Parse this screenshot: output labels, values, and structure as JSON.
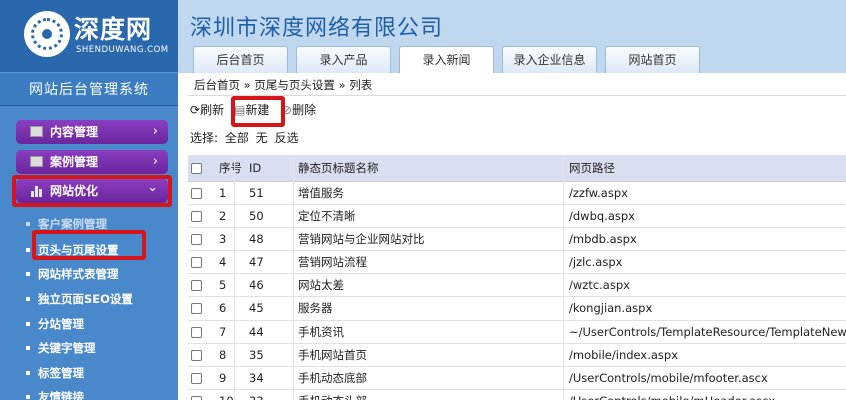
{
  "brand": {
    "name_cn": "深度网",
    "name_en": "SHENDUWANG.COM"
  },
  "system_title": "网站后台管理系统",
  "company": "深圳市深度网络有限公司",
  "tabs": [
    {
      "label": "后台首页",
      "active": false
    },
    {
      "label": "录入产品",
      "active": false
    },
    {
      "label": "录入新闻",
      "active": true
    },
    {
      "label": "录入企业信息",
      "active": false
    },
    {
      "label": "网站首页",
      "active": false
    }
  ],
  "sidebar": {
    "menus": [
      {
        "label": "内容管理",
        "icon": "window-icon",
        "chevron": "›"
      },
      {
        "label": "案例管理",
        "icon": "window-icon",
        "chevron": "›"
      },
      {
        "label": "网站优化",
        "icon": "bar-chart-icon",
        "chevron": "⌄"
      }
    ],
    "subitems": [
      "客户案例管理",
      "页头与页尾设置",
      "网站样式表管理",
      "独立页面SEO设置",
      "分站管理",
      "关键字管理",
      "标签管理",
      "友情链接"
    ]
  },
  "breadcrumb": "后台首页 » 页尾与页头设置 » 列表",
  "toolbar": {
    "refresh": "刷新",
    "new": "新建",
    "delete": "删除"
  },
  "select": {
    "label": "选择:",
    "all": "全部",
    "none": "无",
    "invert": "反选"
  },
  "table": {
    "columns": {
      "no": "序号",
      "id": "ID",
      "name": "静态页标题名称",
      "path": "网页路径"
    },
    "rows": [
      {
        "no": "1",
        "id": "51",
        "name": "增值服务",
        "path": "/zzfw.aspx"
      },
      {
        "no": "2",
        "id": "50",
        "name": "定位不清晰",
        "path": "/dwbq.aspx"
      },
      {
        "no": "3",
        "id": "48",
        "name": "营销网站与企业网站对比",
        "path": "/mbdb.aspx"
      },
      {
        "no": "4",
        "id": "47",
        "name": "营销网站流程",
        "path": "/jzlc.aspx"
      },
      {
        "no": "5",
        "id": "46",
        "name": "网站太差",
        "path": "/wztc.aspx"
      },
      {
        "no": "6",
        "id": "45",
        "name": "服务器",
        "path": "/kongjian.aspx"
      },
      {
        "no": "7",
        "id": "44",
        "name": "手机资讯",
        "path": "~/UserControls/TemplateResource/TemplateNewsGr"
      },
      {
        "no": "8",
        "id": "35",
        "name": "手机网站首页",
        "path": "/mobile/index.aspx"
      },
      {
        "no": "9",
        "id": "34",
        "name": "手机动态底部",
        "path": "/UserControls/mobile/mfooter.ascx"
      },
      {
        "no": "10",
        "id": "33",
        "name": "手机动态头部",
        "path": "/UserControls/mobile/mHeader.ascx"
      }
    ]
  }
}
